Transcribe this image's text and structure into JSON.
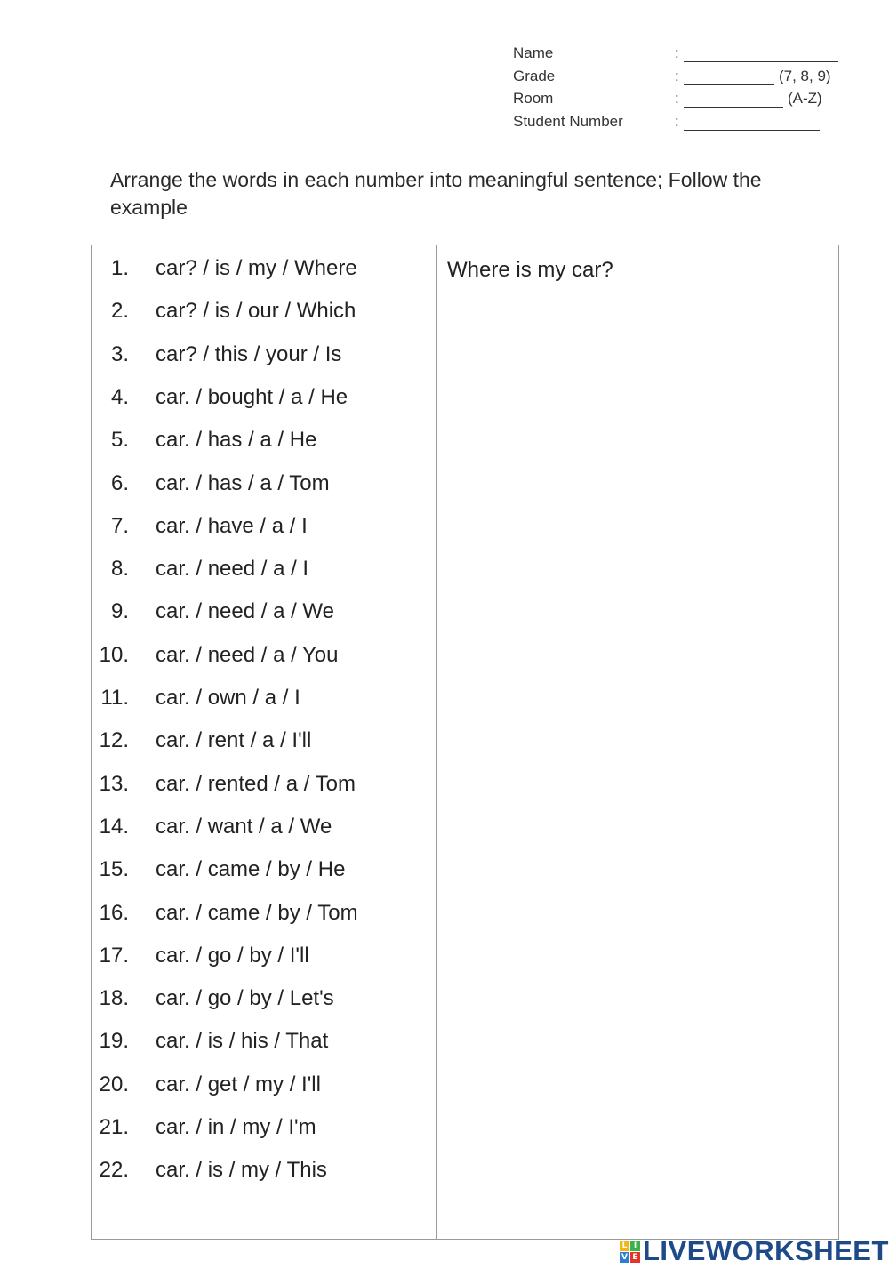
{
  "header": {
    "fields": [
      {
        "label": "Name",
        "colon": ":",
        "hint": ""
      },
      {
        "label": "Grade",
        "colon": ":",
        "hint": "(7, 8, 9)"
      },
      {
        "label": "Room",
        "colon": ":",
        "hint": "(A-Z)"
      },
      {
        "label": "Student Number",
        "colon": ":",
        "hint": ""
      }
    ]
  },
  "instructions": "Arrange the words in each number into meaningful sentence; Follow the example",
  "items": [
    {
      "num": "1.",
      "words": "car? / is / my / Where"
    },
    {
      "num": "2.",
      "words": "car? / is / our / Which"
    },
    {
      "num": "3.",
      "words": "car? / this / your / Is"
    },
    {
      "num": "4.",
      "words": "car. / bought / a / He"
    },
    {
      "num": "5.",
      "words": "car. / has / a / He"
    },
    {
      "num": "6.",
      "words": "car. / has / a / Tom"
    },
    {
      "num": "7.",
      "words": "car. / have / a / I"
    },
    {
      "num": "8.",
      "words": "car. / need / a / I"
    },
    {
      "num": "9.",
      "words": "car. / need / a / We"
    },
    {
      "num": "10.",
      "words": "car. / need / a / You"
    },
    {
      "num": "11.",
      "words": "car. / own / a / I"
    },
    {
      "num": "12.",
      "words": "car. / rent / a / I'll"
    },
    {
      "num": "13.",
      "words": "car. / rented / a / Tom"
    },
    {
      "num": "14.",
      "words": "car. / want / a / We"
    },
    {
      "num": "15.",
      "words": "car. / came / by / He"
    },
    {
      "num": "16.",
      "words": "car. / came / by / Tom"
    },
    {
      "num": "17.",
      "words": "car. / go / by / I'll"
    },
    {
      "num": "18.",
      "words": "car. / go / by / Let's"
    },
    {
      "num": "19.",
      "words": "car. / is / his / That"
    },
    {
      "num": "20.",
      "words": "car. / get / my / I'll"
    },
    {
      "num": "21.",
      "words": "car. / in / my / I'm"
    },
    {
      "num": "22.",
      "words": "car. / is / my / This"
    }
  ],
  "example_answer": "Where is my car?",
  "logo": {
    "blocks": [
      "L",
      "I",
      "V",
      "E"
    ],
    "block_colors": [
      "#f2b417",
      "#3cb34a",
      "#2f7fd1",
      "#e0352b"
    ],
    "text": "LIVEWORKSHEETS",
    "color": "#1f4a8a"
  }
}
